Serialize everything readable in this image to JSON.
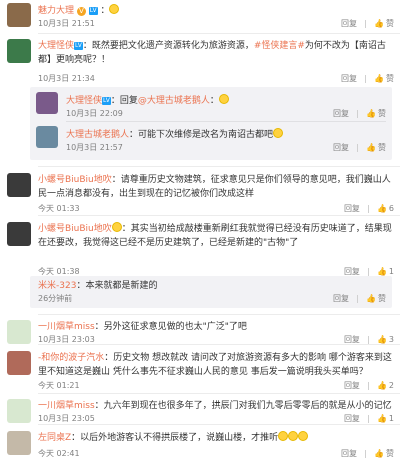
{
  "top": {
    "user": "魅力大理",
    "time": "10月3日 21:51",
    "reply": "回复",
    "like": "赞"
  },
  "c1": {
    "user": "大理怪侠",
    "text_a": "：既然要把文化遗产资源转化为旅游资源，",
    "hashtag": "#怪侠建言#",
    "text_b": "为何不改为【南诏古都】更响亮呢？！",
    "time": "10月3日 21:34",
    "reply": "回复",
    "like": "赞"
  },
  "c1r1": {
    "user": "大理怪侠",
    "text_a": "：回复",
    "mention": "@大理古城老鹅人",
    "text_b": "：",
    "time": "10月3日 22:09",
    "reply": "回复",
    "like": "赞"
  },
  "c1r2": {
    "user": "大理古城老鹅人",
    "text": "：可能下次维修是改名为南诏古都吧",
    "time": "10月3日 21:57",
    "reply": "回复",
    "like": "赞"
  },
  "c2": {
    "user": "小螺号BiuBiu地吹",
    "text": "：请尊重历史文物建筑，征求意见只是你们领导的意见吧，我们巍山人民一点消息都没有，出生到现在的记忆被你们改成这样",
    "time": "今天 01:33",
    "reply": "回复",
    "likes": "6"
  },
  "c3": {
    "user": "小螺号BiuBiu地吹",
    "text": "：其实当初给成敲楼重新刷红我就觉得已经没有历史味道了，结果现在还要改，我觉得这已经不是历史建筑了，已经是新建的\"古物\"了",
    "time": "今天 01:38",
    "reply": "回复",
    "likes": "1"
  },
  "c3r1": {
    "user": "米米-323",
    "text": "：本来就都是新建的",
    "time": "26分钟前",
    "reply": "回复",
    "like": "赞"
  },
  "c4": {
    "user": "一川烟草miss",
    "text": "：另外这征求意见做的也太\"广泛\"了吧",
    "time": "10月3日 23:03",
    "reply": "回复",
    "likes": "3"
  },
  "c5": {
    "user": "-和你的波子汽水",
    "text": "：历史文物 想改就改 请问改了对旅游资源有多大的影响 哪个游客来到这里不知道这是巍山 凭什么事先不征求巍山人民的意见 事后发一篇说明我头买单吗？",
    "time": "今天 01:21",
    "reply": "回复",
    "likes": "2"
  },
  "c6": {
    "user": "一川烟草miss",
    "text": "：九六年到现在也很多年了，拱辰门对我们九零后零零后的就是从小的记忆",
    "time": "10月3日 23:05",
    "reply": "回复",
    "likes": "1"
  },
  "c7": {
    "user": "左同桌Z",
    "text": "：以后外地游客认不得拱辰楼了，说巍山楼，才推听",
    "time": "今天 02:41",
    "reply": "回复",
    "like": "赞"
  }
}
